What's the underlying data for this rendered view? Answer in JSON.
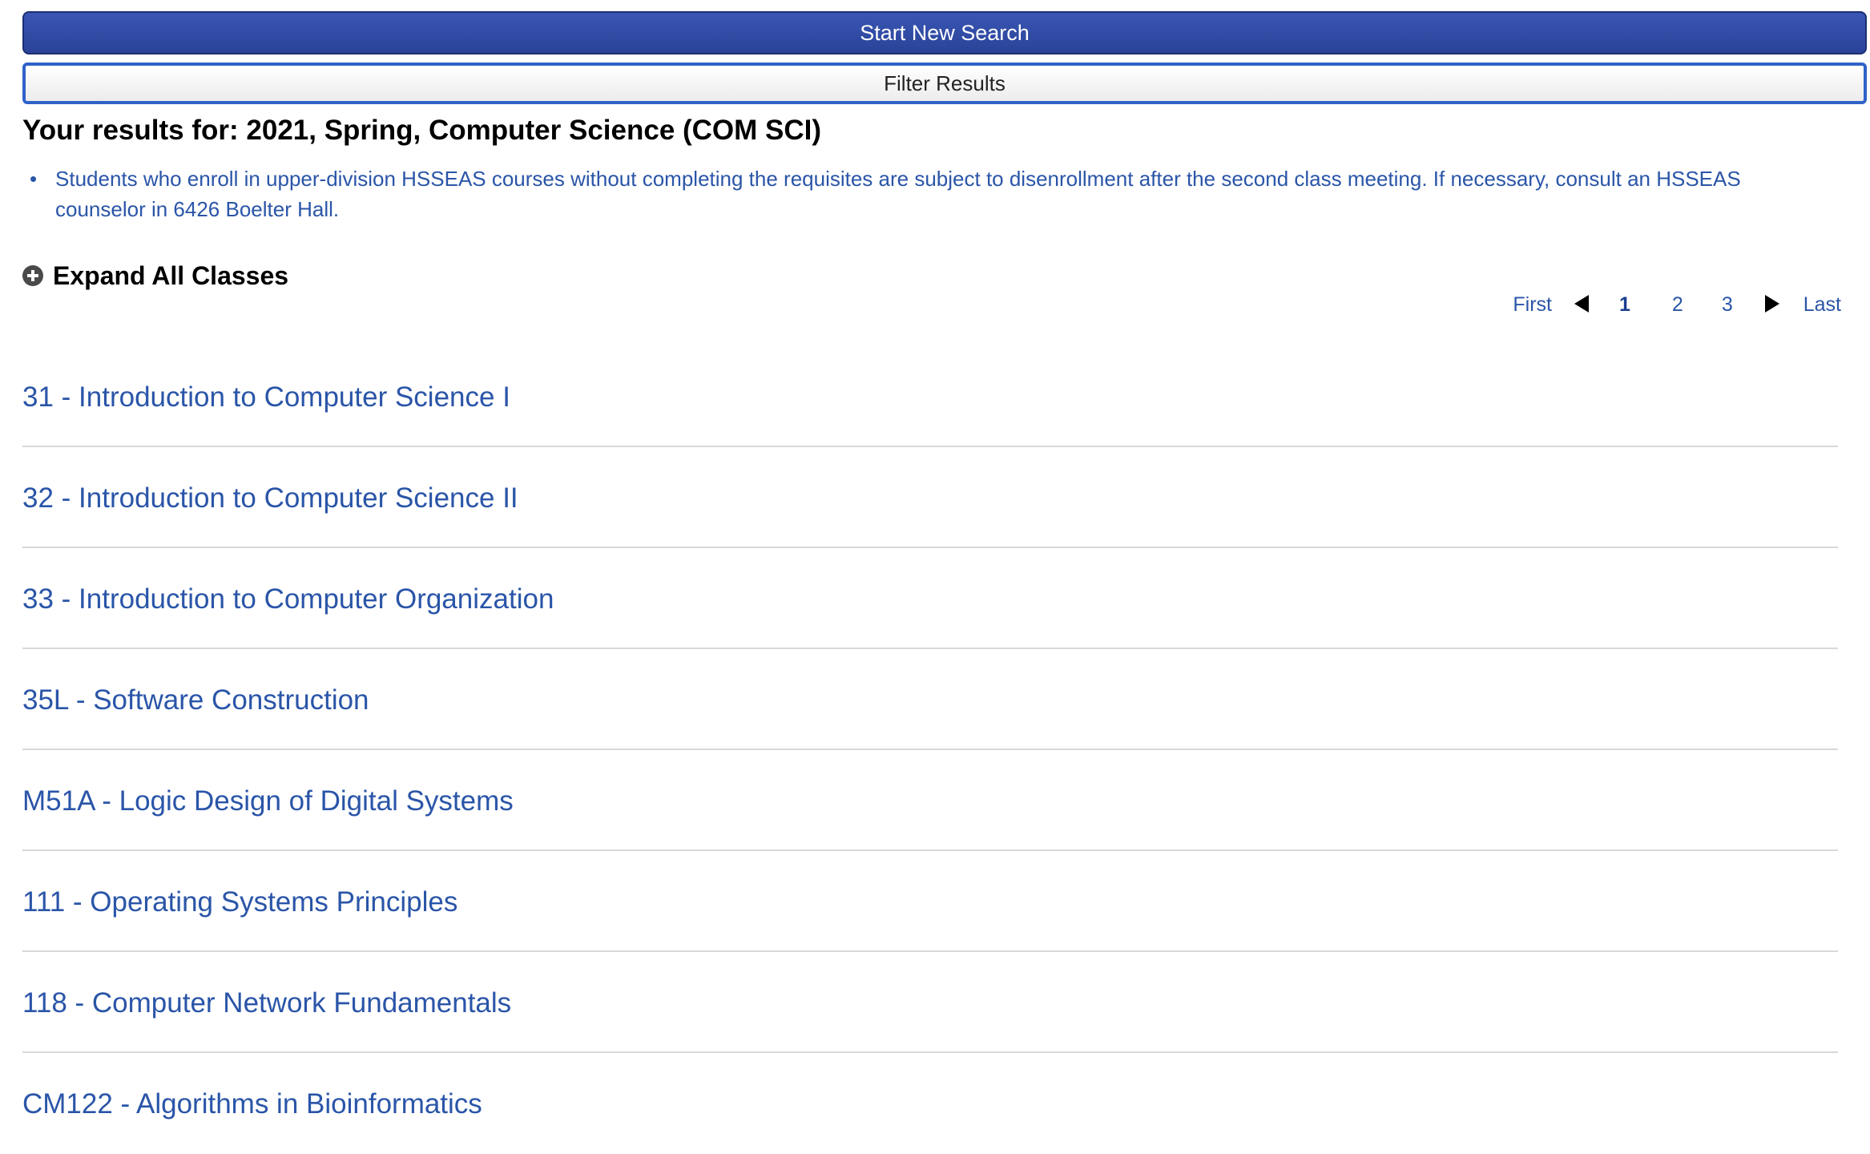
{
  "buttons": {
    "start_new_search": "Start New Search",
    "filter_results": "Filter Results"
  },
  "results_title": "Your results for: 2021, Spring, Computer Science (COM SCI)",
  "notes": [
    "Students who enroll in upper-division HSSEAS courses without completing the requisites are subject to disenrollment after the second class meeting. If necessary, consult an HSSEAS counselor in 6426 Boelter Hall."
  ],
  "expand_all_label": "Expand All Classes",
  "pagination": {
    "first": "First",
    "last": "Last",
    "pages": [
      "1",
      "2",
      "3"
    ],
    "current_page": "1"
  },
  "courses": [
    "31 - Introduction to Computer Science I",
    "32 - Introduction to Computer Science II",
    "33 - Introduction to Computer Organization",
    "35L - Software Construction",
    "M51A - Logic Design of Digital Systems",
    "111 - Operating Systems Principles",
    "118 - Computer Network Fundamentals",
    "CM122 - Algorithms in Bioinformatics"
  ],
  "colors": {
    "primary_button": "#2a4399",
    "link_blue": "#2a55a8",
    "divider": "#d8d8d8"
  },
  "icons": {
    "expand": "plus-circle-icon",
    "prev": "triangle-left-icon",
    "next": "triangle-right-icon"
  }
}
